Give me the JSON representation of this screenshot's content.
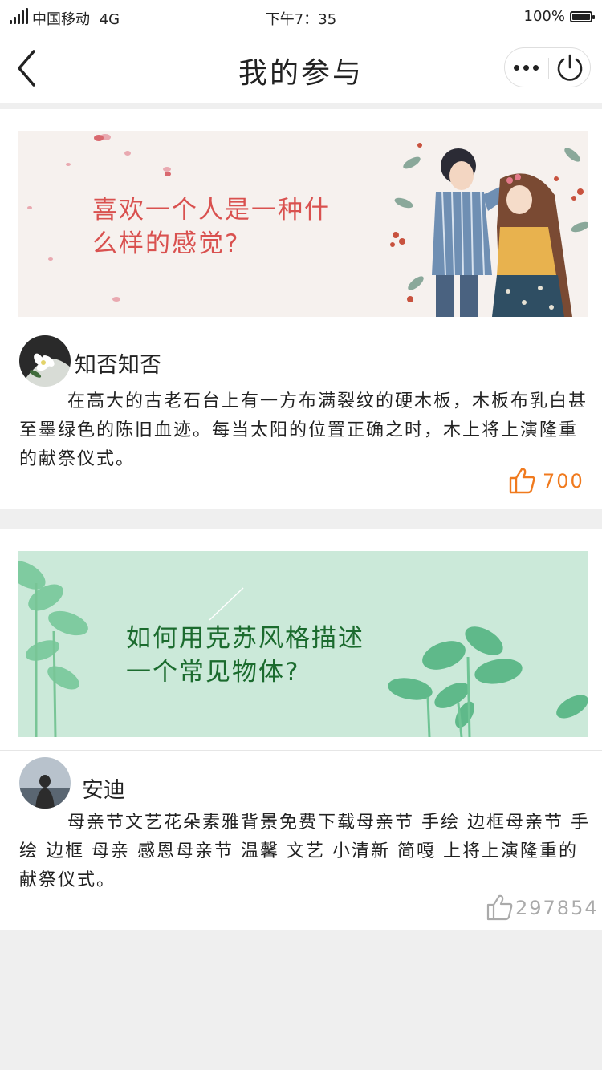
{
  "status": {
    "carrier": "中国移动",
    "network": "4G",
    "time": "下午7：35",
    "battery_text": "100%",
    "battery_level": 1.0
  },
  "nav": {
    "title": "我的参与",
    "back_icon": "chevron-left-icon",
    "more_icon": "more-dots-icon",
    "close_icon": "power-icon"
  },
  "posts": [
    {
      "banner_title_lines": [
        "喜欢一个人是一种什",
        "么样的感觉?"
      ],
      "banner_title_color": "#d9514f",
      "author": "知否知否",
      "body": "在高大的古老石台上有一方布满裂纹的硬木板，木板布乳白甚至墨绿色的陈旧血迹。每当太阳的位置正确之时，木上将上演隆重的献祭仪式。",
      "likes": "700",
      "likes_color": "#f07a1e"
    },
    {
      "banner_title_lines": [
        "如何用克苏风格描述",
        "一个常见物体?"
      ],
      "banner_title_color": "#1b6b2e",
      "author": "安迪",
      "body": "母亲节文艺花朵素雅背景免费下载母亲节  手绘  边框母亲节 手绘 边框 母亲 感恩母亲节 温馨 文艺 小清新 简嘎 上将上演隆重的献祭仪式。",
      "likes": "297854",
      "likes_color": "#aaaaaa"
    }
  ]
}
